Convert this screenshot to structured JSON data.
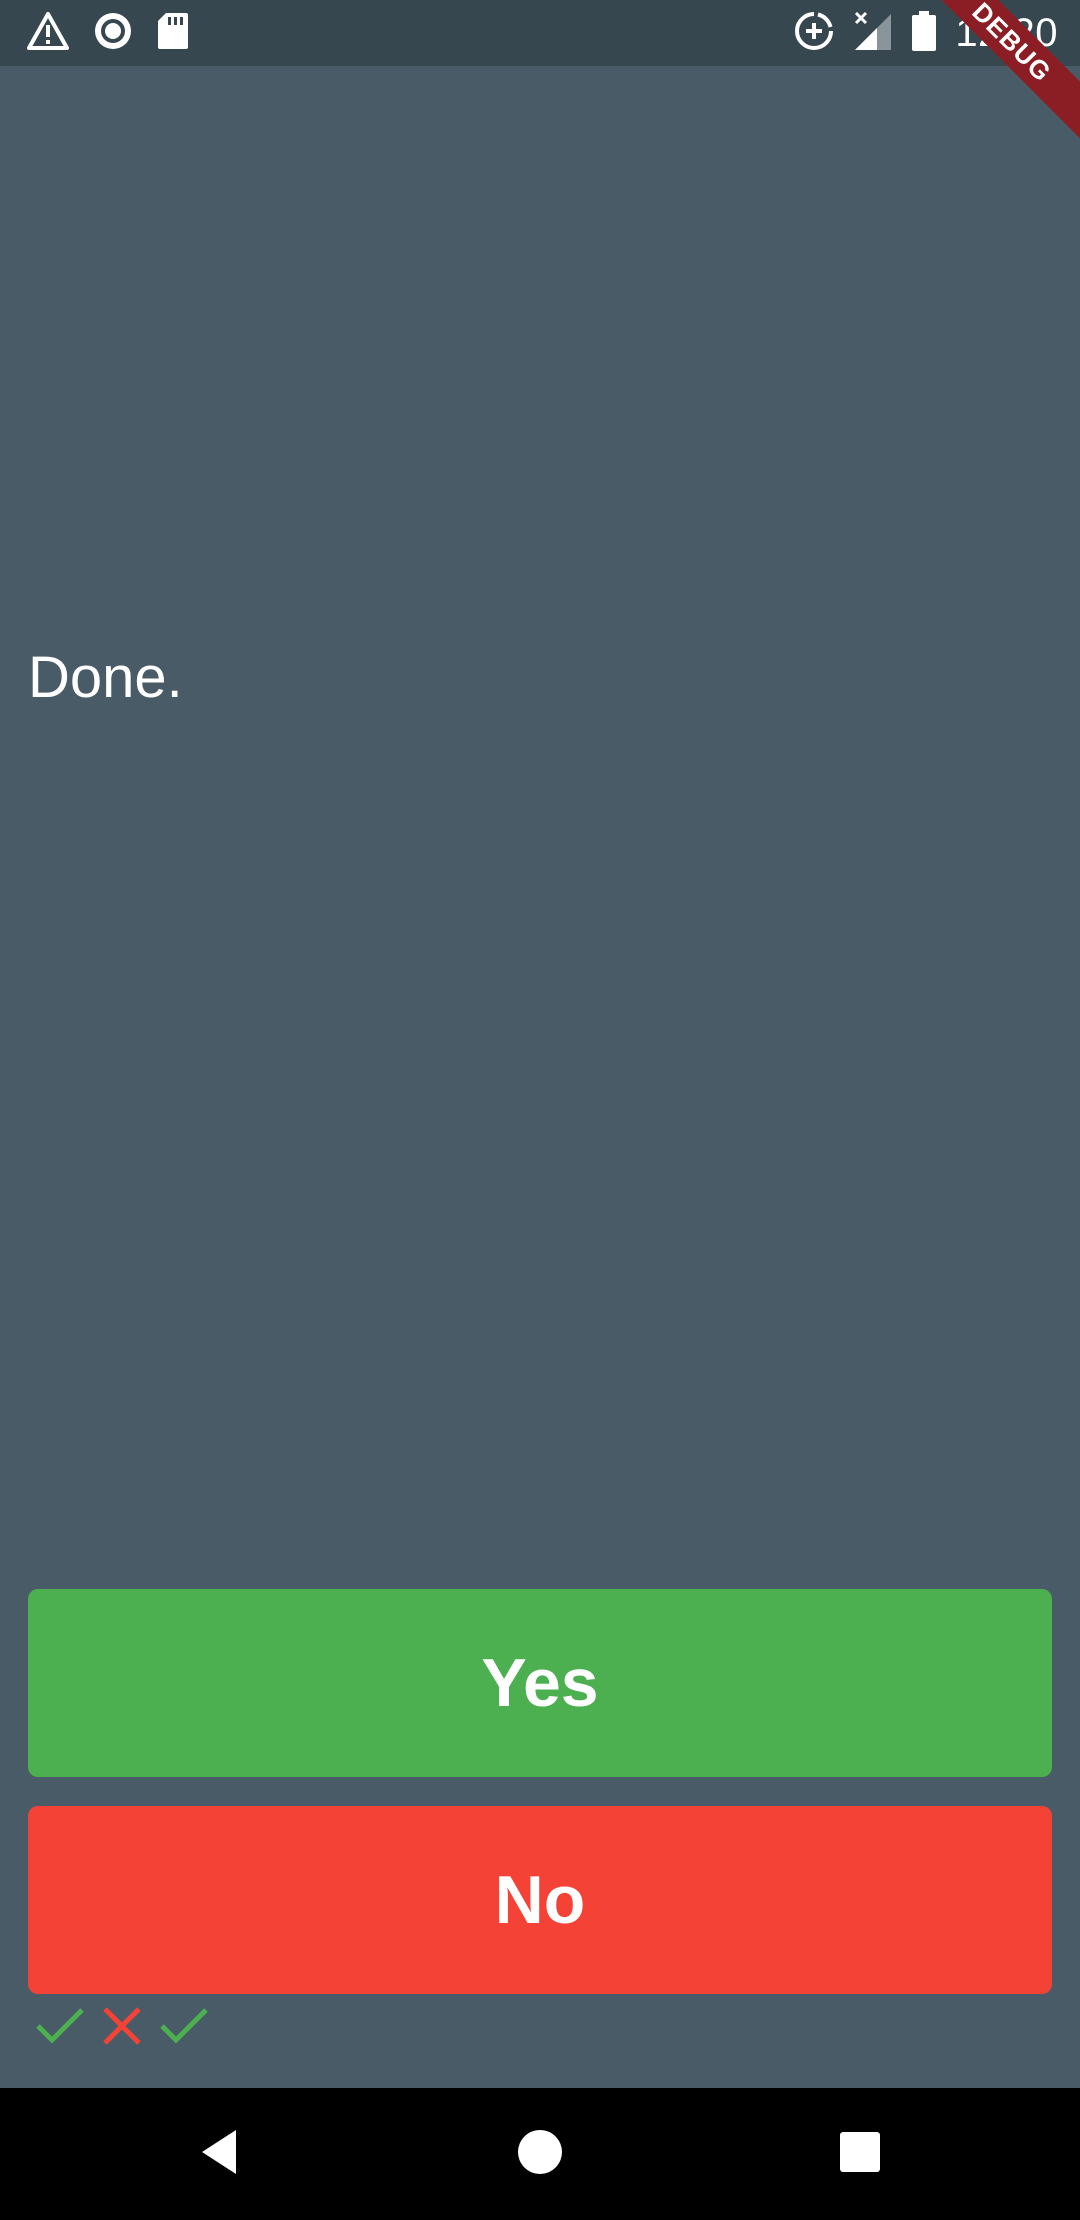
{
  "status_bar": {
    "time": "12:20",
    "left_icons": [
      "warning-icon",
      "circle-target-icon",
      "sd-card-icon"
    ],
    "right_icons": [
      "data-saver-icon",
      "signal-icon",
      "battery-icon"
    ],
    "debug_label": "DEBUG"
  },
  "main": {
    "message": "Done."
  },
  "buttons": {
    "yes_label": "Yes",
    "no_label": "No"
  },
  "history": [
    "check-icon",
    "cross-icon",
    "check-icon"
  ],
  "colors": {
    "background": "#485b66",
    "status_bar": "#37474f",
    "yes": "#4caf50",
    "no": "#f44336",
    "debug": "#8b1e24"
  },
  "nav_bar": {
    "icons": [
      "back-icon",
      "home-icon",
      "recents-icon"
    ]
  }
}
